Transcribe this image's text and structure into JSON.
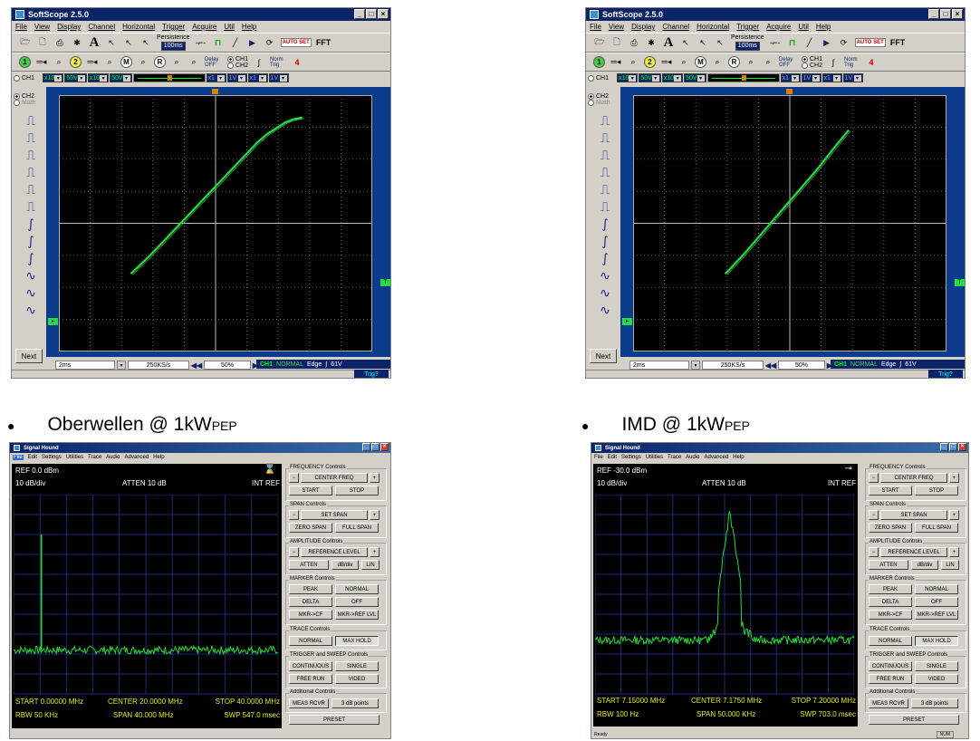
{
  "scope_left": {
    "title": "SoftScope 2.5.0",
    "menu": [
      "File",
      "View",
      "Display",
      "Channel",
      "Horizontal",
      "Trigger",
      "Acquire",
      "Util",
      "Help"
    ],
    "persistence_label": "Persistence",
    "persistence_value": "100ms",
    "autoset_label": "AUTO SET",
    "fft_label": "FFT",
    "delay_label": "Delay OFF",
    "ch1_radio": "CH1",
    "ch2_radio": "CH2",
    "norm_trig": "Norm Trig",
    "ch1_probe": "x10",
    "ch1_volts": "50V",
    "ch2_probe": "x10",
    "ch2_volts": "50V",
    "math_probe1": "x1",
    "math_volts1": "1V",
    "math_probe2": "x1",
    "math_volts2": "1V",
    "side_ch1": "CH1",
    "side_ch2": "CH2",
    "side_math": "Math",
    "next_label": "Next",
    "timebase": "2ms",
    "sample_rate": "250KS/s",
    "position": "50%",
    "trig_channel": "CH1",
    "trig_mode": "NORMAL",
    "trig_type": "Edge",
    "trig_level": "61V",
    "trig_button": "Trig?"
  },
  "scope_right": {
    "title": "SoftScope 2.5.0",
    "menu": [
      "File",
      "View",
      "Display",
      "Channel",
      "Horizontal",
      "Trigger",
      "Acquire",
      "Util",
      "Help"
    ],
    "persistence_label": "Persistence",
    "persistence_value": "100ms",
    "autoset_label": "AUTO SET",
    "fft_label": "FFT",
    "delay_label": "Delay OFF",
    "ch1_radio": "CH1",
    "ch2_radio": "CH2",
    "norm_trig": "Norm Trig",
    "ch1_probe": "x10",
    "ch1_volts": "50V",
    "ch2_probe": "x10",
    "ch2_volts": "50V",
    "math_probe1": "x1",
    "math_volts1": "1V",
    "math_probe2": "x1",
    "math_volts2": "1V",
    "side_ch1": "CH1",
    "side_ch2": "CH2",
    "side_math": "Math",
    "next_label": "Next",
    "timebase": "2ms",
    "sample_rate": "250KS/s",
    "position": "50%",
    "trig_channel": "CH1",
    "trig_mode": "NORMAL",
    "trig_type": "Edge",
    "trig_level": "61V",
    "trig_button": "Trig?"
  },
  "caption_left": {
    "text": "Oberwellen @ 1kW",
    "sub": "PEP"
  },
  "caption_right": {
    "text": "IMD @ 1kW",
    "sub": "PEP"
  },
  "sh_left": {
    "title": "Signal Hound",
    "menu": [
      "File",
      "Edit",
      "Settings",
      "Utilities",
      "Trace",
      "Audio",
      "Advanced",
      "Help"
    ],
    "ref": "REF 0.0 dBm",
    "scale": "10 dB/div",
    "atten": "ATTEN 10 dB",
    "int_ref": "INT REF",
    "start": "START 0.00000 MHz",
    "center": "CENTER 20.0000 MHz",
    "stop": "STOP 40.0000 MHz",
    "rbw": "RBW 50 KHz",
    "span": "SPAN 40.000 MHz",
    "swp": "SWP 547.0 msec",
    "status": ""
  },
  "sh_right": {
    "title": "Signal Hound",
    "menu": [
      "File",
      "Edit",
      "Settings",
      "Utilities",
      "Trace",
      "Audio",
      "Advanced",
      "Help"
    ],
    "ref": "REF -30.0 dBm",
    "scale": "10 dB/div",
    "atten": "ATTEN 10 dB",
    "int_ref": "INT REF",
    "start": "START 7.15000 MHz",
    "center": "CENTER 7.1750 MHz",
    "stop": "STOP 7.20000 MHz",
    "rbw": "RBW 100 Hz",
    "span": "SPAN 50.000 KHz",
    "swp": "SWP 703.0 msec",
    "status": "Ready",
    "status_right": "NUM"
  },
  "sh_controls": {
    "frequency": "FREQUENCY Controls",
    "minus": "−",
    "plus": "+",
    "center_freq": "CENTER FREQ",
    "start": "START",
    "stop": "STOP",
    "span": "SPAN Controls",
    "set_span": "SET SPAN",
    "zero_span": "ZERO SPAN",
    "full_span": "FULL SPAN",
    "amplitude": "AMPLITUDE Controls",
    "ref_level": "REFERENCE LEVEL",
    "atten": "ATTEN",
    "db_div": "dB/div",
    "lin": "LIN",
    "marker": "MARKER Controls",
    "peak": "PEAK",
    "normal": "NORMAL",
    "delta": "DELTA",
    "off": "OFF",
    "mkr_cf": "MKR->CF",
    "mkr_ref": "MKR->REF LVL",
    "trace": "TRACE Controls",
    "trace_normal": "NORMAL",
    "max_hold": "MAX HOLD",
    "trigger": "TRIGGER and SWEEP Controls",
    "continuous": "CONTINUOUS",
    "single": "SINGLE",
    "free_run": "FREE RUN",
    "video": "VIDEO",
    "additional": "Additional Controls",
    "meas_rcvr": "MEAS RCVR",
    "db3": "3 dB points",
    "preset": "PRESET"
  },
  "chart_data": [
    {
      "type": "scatter",
      "name": "scope_left_xy",
      "x": [
        -4.6,
        -3.6,
        -2.6,
        -1.6,
        -0.6,
        0.4,
        1.2,
        1.8,
        2.3,
        2.8,
        3.3,
        3.8,
        4.2,
        4.7
      ],
      "y": [
        -2.6,
        -1.7,
        -0.7,
        0.3,
        1.3,
        2.3,
        3.1,
        3.7,
        4.2,
        4.6,
        4.9,
        5.2,
        5.35,
        5.45
      ],
      "xlim": [
        -8.5,
        8.5
      ],
      "ylim": [
        -6.6,
        6.6
      ],
      "grid": true
    },
    {
      "type": "scatter",
      "name": "scope_right_xy",
      "x": [
        -3.5,
        -2.5,
        -1.5,
        -0.5,
        0.5,
        1.5,
        2.5,
        3.2
      ],
      "y": [
        -2.6,
        -1.6,
        -0.5,
        0.6,
        1.7,
        2.8,
        4.0,
        4.8
      ],
      "xlim": [
        -8.5,
        8.5
      ],
      "ylim": [
        -6.6,
        6.6
      ],
      "grid": true
    },
    {
      "type": "line",
      "name": "sh_left_spectrum",
      "x": [
        0,
        5,
        10,
        15,
        20,
        25,
        30,
        35,
        40
      ],
      "peak": {
        "x": 4.2,
        "y": -20
      },
      "floor_db": -78,
      "ylim": [
        -100,
        0
      ],
      "xlabel": "",
      "ylabel": ""
    },
    {
      "type": "line",
      "name": "sh_right_spectrum",
      "x": [
        7.15,
        7.175,
        7.2
      ],
      "peak": {
        "x": 7.176,
        "y": -38
      },
      "floor_db": -103,
      "ylim": [
        -130,
        -30
      ],
      "xlabel": "",
      "ylabel": ""
    }
  ]
}
